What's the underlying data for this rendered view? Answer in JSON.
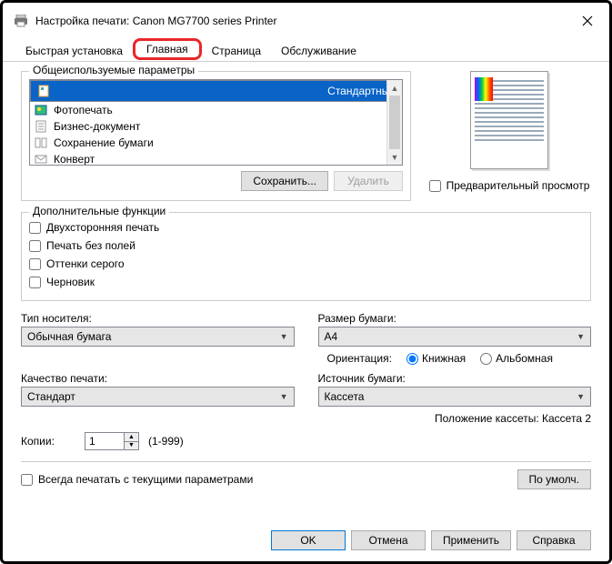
{
  "window": {
    "title": "Настройка печати: Canon MG7700 series Printer"
  },
  "tabs": {
    "quick": "Быстрая установка",
    "main": "Главная",
    "page": "Страница",
    "service": "Обслуживание"
  },
  "profiles": {
    "legend": "Общеиспользуемые параметры",
    "items": {
      "standard": "Стандартные",
      "photo": "Фотопечать",
      "business": "Бизнес-документ",
      "paper_save": "Сохранение бумаги",
      "envelope": "Конверт"
    },
    "save": "Сохранить...",
    "delete": "Удалить"
  },
  "preview": {
    "checkbox": "Предварительный просмотр"
  },
  "funcs": {
    "legend": "Дополнительные функции",
    "duplex": "Двухсторонняя печать",
    "borderless": "Печать без полей",
    "grayscale": "Оттенки серого",
    "draft": "Черновик"
  },
  "media": {
    "type_label": "Тип носителя:",
    "type_value": "Обычная бумага",
    "quality_label": "Качество печати:",
    "quality_value": "Стандарт"
  },
  "size": {
    "label": "Размер бумаги:",
    "value": "A4",
    "orient_label": "Ориентация:",
    "portrait": "Книжная",
    "landscape": "Альбомная",
    "source_label": "Источник бумаги:",
    "source_value": "Кассета",
    "position_note": "Положение кассеты: Кассета 2"
  },
  "copies": {
    "label": "Копии:",
    "value": "1",
    "range": "(1-999)"
  },
  "always": {
    "label": "Всегда печатать с текущими параметрами"
  },
  "defaults": {
    "label": "По умолч."
  },
  "footer": {
    "ok": "OK",
    "cancel": "Отмена",
    "apply": "Применить",
    "help": "Справка"
  }
}
